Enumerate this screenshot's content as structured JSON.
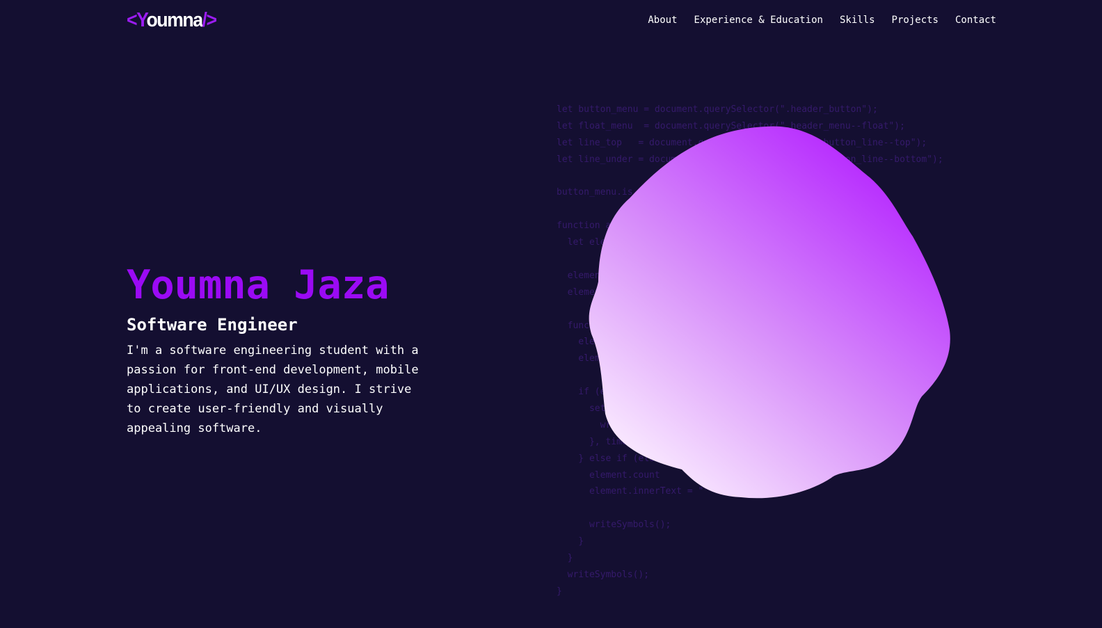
{
  "header": {
    "logo": {
      "open_bracket": "<",
      "first_letter": "Y",
      "rest": "oumna",
      "close": "/>"
    },
    "nav": [
      {
        "label": "About"
      },
      {
        "label": "Experience & Education"
      },
      {
        "label": "Skills"
      },
      {
        "label": "Projects"
      },
      {
        "label": "Contact"
      }
    ]
  },
  "hero": {
    "name": "Youmna Jaza",
    "role": "Software Engineer",
    "description": "I'm a software engineering student with a passion for front-end development, mobile applications, and UI/UX design. I strive to create user-friendly and visually appealing software."
  },
  "code_background": [
    "let button_menu = document.querySelector(\".header_button\");",
    "let float_menu  = document.querySelector(\".header_menu--float\");",
    "let line_top   = document.querySelector(\".header_button_line--top\");",
    "let line_under = document.querySelector(\".header_button_line--bottom\");",
    "",
    "button_menu.is",
    "",
    "function a",
    "  let ele",
    "",
    "  elemen",
    "  elemen",
    "",
    "  func",
    "    ele",
    "    elem",
    "",
    "    if (e",
    "      set",
    "        wri",
    "      }, time",
    "    } else if (ele",
    "      element.count",
    "      element.innerText = \"\"",
    "",
    "      writeSymbols();",
    "    }",
    "  }",
    "  writeSymbols();",
    "}"
  ],
  "colors": {
    "background": "#140f31",
    "accent": "#9b0af5",
    "blob_top": "#b21cff",
    "blob_bottom": "#fbeeff",
    "code_text": "#351a6b"
  }
}
